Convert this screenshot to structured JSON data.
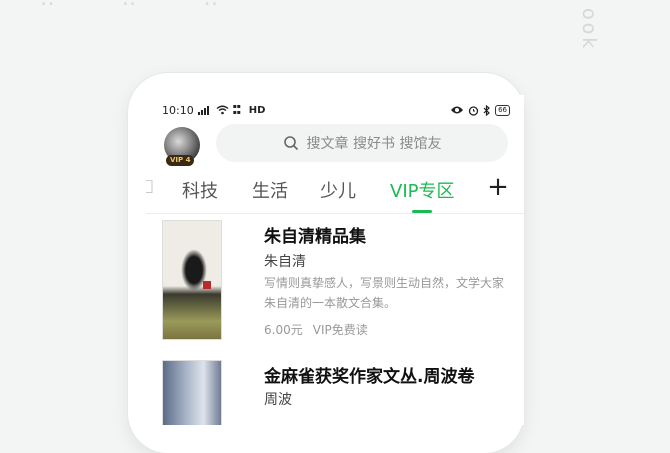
{
  "status_bar": {
    "time": "10:10",
    "network": "HD",
    "battery": "66"
  },
  "header": {
    "avatar_badge": "VIP 4",
    "search_placeholder": "搜文章 搜好书 搜馆友"
  },
  "tabs": [
    {
      "label": "科技",
      "active": false
    },
    {
      "label": "生活",
      "active": false
    },
    {
      "label": "少儿",
      "active": false
    },
    {
      "label": "VIP专区",
      "active": true
    }
  ],
  "books": [
    {
      "title": "朱自清精品集",
      "author": "朱自清",
      "description": "写情则真挚感人，写景则生动自然，文学大家朱自清的一本散文合集。",
      "price": "6.00元",
      "tag": "VIP免费读"
    },
    {
      "title": "金麻雀获奖作家文丛.周波卷",
      "author": "周波"
    }
  ],
  "background": {
    "side_word": "ook"
  },
  "colors": {
    "accent": "#1db954",
    "background": "#f3f4f4"
  }
}
